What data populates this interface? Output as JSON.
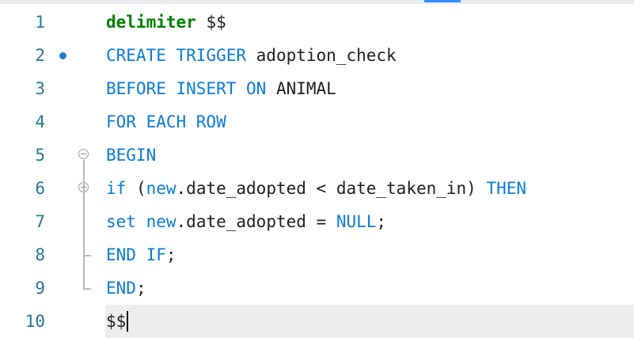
{
  "editor": {
    "lines": [
      {
        "number": "1",
        "tokens": [
          {
            "t": "delimiter",
            "c": "kw-green"
          },
          {
            "t": " $$",
            "c": "id"
          }
        ]
      },
      {
        "number": "2",
        "tokens": [
          {
            "t": "CREATE TRIGGER",
            "c": "kw"
          },
          {
            "t": " adoption_check",
            "c": "id"
          }
        ]
      },
      {
        "number": "3",
        "tokens": [
          {
            "t": "BEFORE INSERT ON",
            "c": "kw"
          },
          {
            "t": " ANIMAL",
            "c": "id"
          }
        ]
      },
      {
        "number": "4",
        "tokens": [
          {
            "t": "FOR EACH ROW",
            "c": "kw"
          }
        ]
      },
      {
        "number": "5",
        "tokens": [
          {
            "t": "BEGIN",
            "c": "kw"
          }
        ]
      },
      {
        "number": "6",
        "tokens": [
          {
            "t": "if",
            "c": "kw"
          },
          {
            "t": " (",
            "c": "op"
          },
          {
            "t": "new",
            "c": "kw"
          },
          {
            "t": ".date_adopted < date_taken_in) ",
            "c": "id"
          },
          {
            "t": "THEN",
            "c": "kw"
          }
        ]
      },
      {
        "number": "7",
        "tokens": [
          {
            "t": "set",
            "c": "kw"
          },
          {
            "t": " ",
            "c": "id"
          },
          {
            "t": "new",
            "c": "kw"
          },
          {
            "t": ".date_adopted = ",
            "c": "id"
          },
          {
            "t": "NULL",
            "c": "kw"
          },
          {
            "t": ";",
            "c": "op"
          }
        ]
      },
      {
        "number": "8",
        "tokens": [
          {
            "t": "END IF",
            "c": "kw"
          },
          {
            "t": ";",
            "c": "op"
          }
        ]
      },
      {
        "number": "9",
        "tokens": [
          {
            "t": "END",
            "c": "kw"
          },
          {
            "t": ";",
            "c": "op"
          }
        ]
      },
      {
        "number": "10",
        "tokens": [
          {
            "t": "$$",
            "c": "id"
          }
        ]
      }
    ],
    "breakpoint_line": "2",
    "fold_markers": [
      "5",
      "6"
    ],
    "current_line": "10",
    "colors": {
      "keyword": "#0a7bd8",
      "delimiter_keyword": "#008000",
      "line_number": "#237893",
      "breakpoint": "#1a7fd4",
      "current_line_bg": "#eeeeee"
    }
  }
}
